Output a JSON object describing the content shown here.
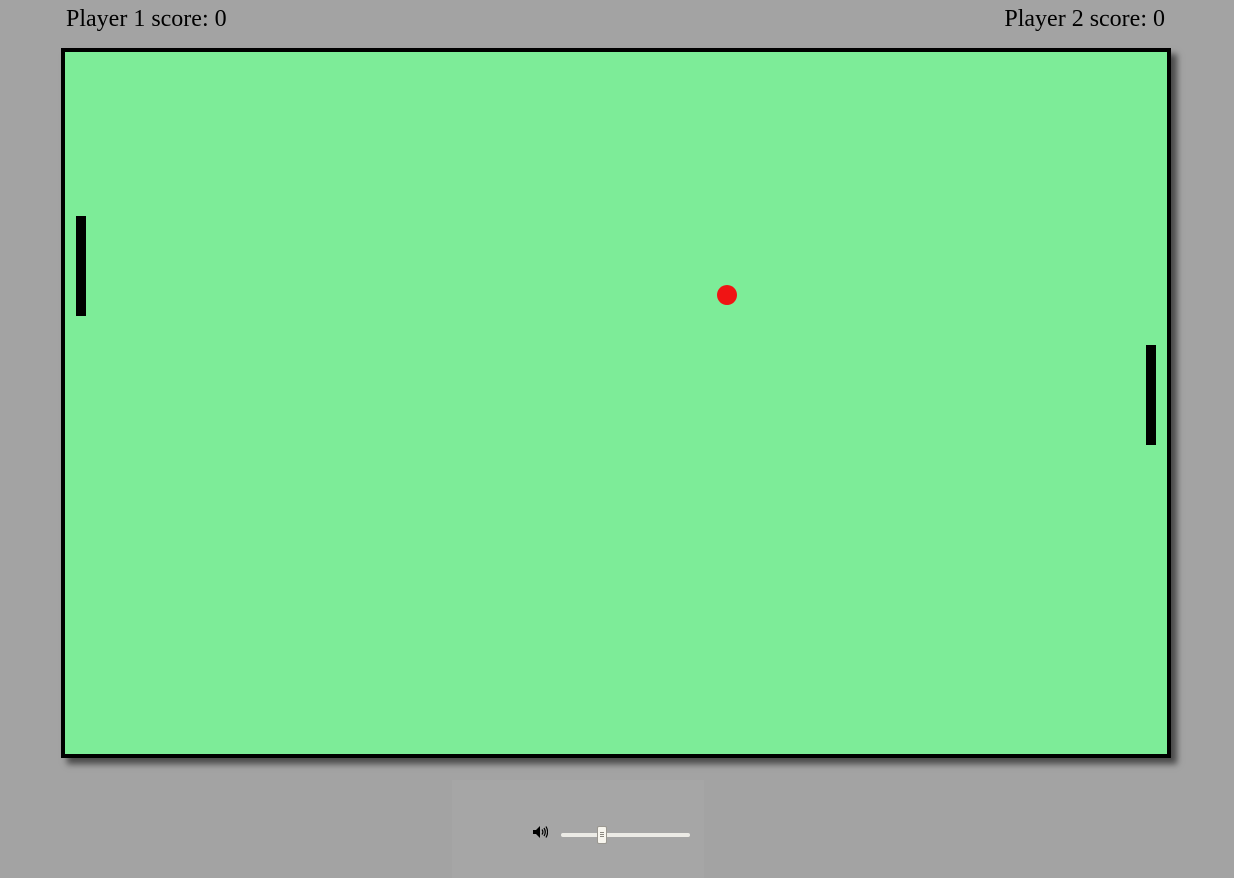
{
  "scores": {
    "player1": "Player 1 score: 0",
    "player2": "Player 2 score: 0"
  },
  "board": {
    "background_color": "#7dec98",
    "border_color": "#000000"
  },
  "ball": {
    "color": "#f01414"
  },
  "paddles": {
    "color": "#000000"
  },
  "volume": {
    "icon": "speaker-icon",
    "level": 0.32
  }
}
